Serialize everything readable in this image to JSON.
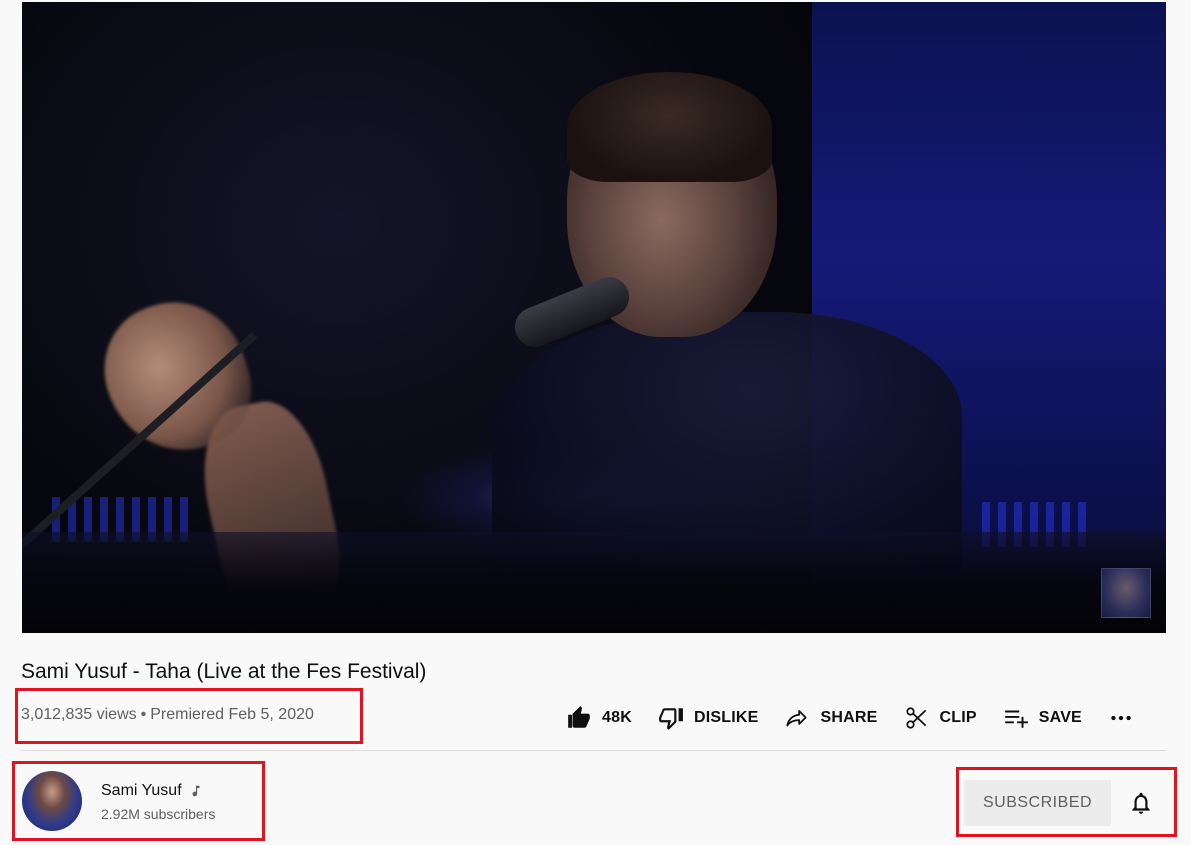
{
  "video": {
    "title": "Sami Yusuf - Taha (Live at the Fes Festival)",
    "views": "3,012,835 views",
    "separator": "•",
    "premiered": "Premiered Feb 5, 2020"
  },
  "actions": {
    "like_count": "48K",
    "dislike_label": "DISLIKE",
    "share_label": "SHARE",
    "clip_label": "CLIP",
    "save_label": "SAVE",
    "icons": [
      "thumbs-up-icon",
      "thumbs-down-icon",
      "share-arrow-icon",
      "scissors-icon",
      "playlist-add-icon",
      "more-horizontal-icon"
    ]
  },
  "channel": {
    "name": "Sami Yusuf",
    "badge_icon": "music-note-icon",
    "subscribers": "2.92M subscribers",
    "subscribe_label": "SUBSCRIBED",
    "bell_icon": "bell-icon"
  },
  "colors": {
    "highlight": "#e0141e",
    "text_primary": "#0f0f0f",
    "text_secondary": "#606060",
    "background": "#f9f9f9",
    "subscribed_bg": "#ececec"
  }
}
